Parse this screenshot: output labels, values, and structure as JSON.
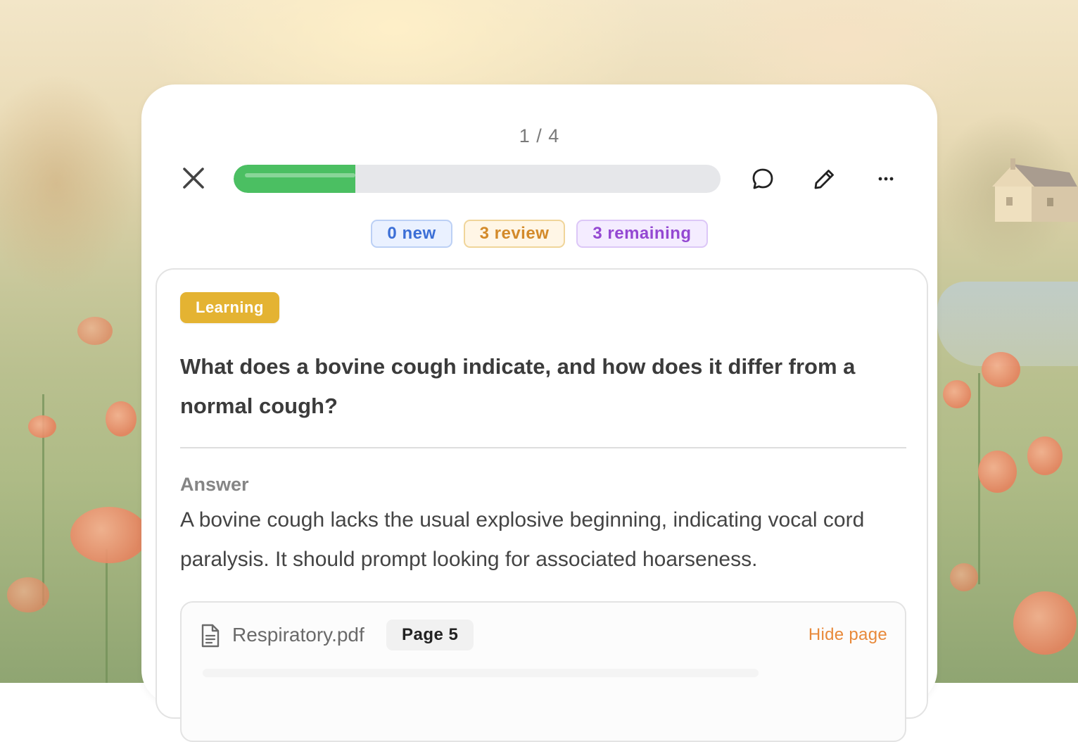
{
  "session": {
    "counter": "1 / 4",
    "progress_fraction": 0.25,
    "progress_color": "#4bbf62"
  },
  "toolbar": {
    "close_icon": "close-icon",
    "comment_icon": "comment-icon",
    "edit_icon": "pencil-icon",
    "more_icon": "more-horizontal-icon"
  },
  "chips": {
    "new": "0 new",
    "review": "3 review",
    "remaining": "3 remaining"
  },
  "card": {
    "badge": "Learning",
    "badge_color": "#e4b332",
    "question": "What does a bovine cough indicate, and how does it differ from a normal cough?",
    "answer_label": "Answer",
    "answer": "A bovine cough lacks the usual explosive beginning, indicating vocal cord paralysis. It should prompt looking for associated hoarseness."
  },
  "source": {
    "file_icon": "document-icon",
    "file_name": "Respiratory.pdf",
    "page": "Page 5",
    "hide_label": "Hide page",
    "link_color": "#e8893a"
  }
}
